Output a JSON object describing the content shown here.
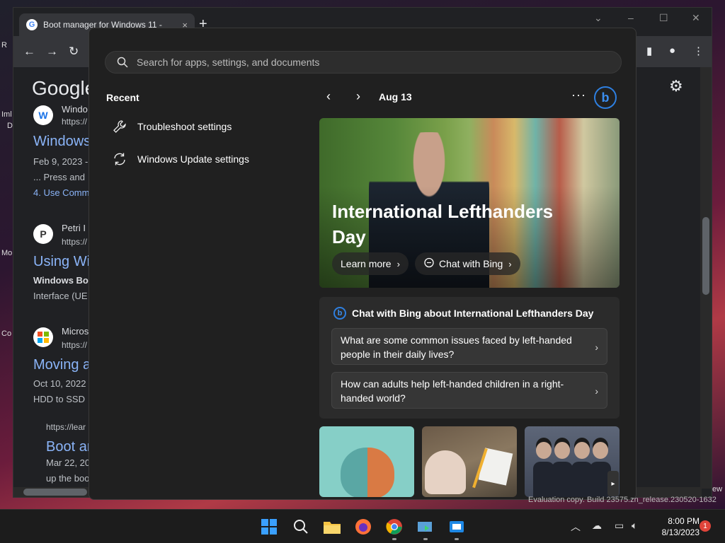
{
  "browser": {
    "tab_title": "Boot manager for Windows 11 -",
    "tab_close": "×",
    "new_tab": "+",
    "logo": "Google",
    "results": [
      {
        "fav": "W",
        "site": "Windo",
        "url": "https://",
        "title": "Windows",
        "snippet1": "Feb 9, 2023 -",
        "snippet2": "... Press and",
        "link": "4. Use Comm"
      },
      {
        "fav": "P",
        "site": "Petri I",
        "url": "https://",
        "title": "Using Wi",
        "snippet1": "Windows Bo",
        "snippet2": "Interface (UE"
      },
      {
        "fav": "",
        "site": "Micros",
        "url": "https://",
        "title": "Moving a",
        "snippet1": "Oct 10, 2022",
        "snippet2": "HDD to SSD"
      },
      {
        "url": "https://lear",
        "title": "Boot ar",
        "snippet1": "Mar 22, 20",
        "snippet2": "up the boo"
      }
    ]
  },
  "flyout": {
    "search_placeholder": "Search for apps, settings, and documents",
    "recent_heading": "Recent",
    "recent_items": [
      {
        "label": "Troubleshoot settings",
        "icon": "wrench-icon"
      },
      {
        "label": "Windows Update settings",
        "icon": "sync-icon"
      }
    ],
    "date": "Aug 13",
    "dots": "···",
    "hero": {
      "title": "International Lefthanders Day",
      "learn_more": "Learn more",
      "chat_bing": "Chat with Bing"
    },
    "bing_card": {
      "heading": "Chat with Bing about International Lefthanders Day",
      "questions": [
        "What are some common issues faced by left-handed people in their daily lives?",
        "How can adults help left-handed children in a right-handed world?"
      ]
    }
  },
  "taskbar": {
    "time": "8:00 PM",
    "date": "8/13/2023",
    "notification_count": "1"
  },
  "watermark": "Evaluation copy. Build 23575.zn_release.230520-1632",
  "desktop": {
    "labels": [
      "R",
      "Iml",
      "D",
      "Mo",
      "Co"
    ],
    "edge_label": "ew"
  },
  "colors": {
    "accent": "#2e7fe0",
    "link": "#8ab4f8",
    "flyout_bg": "#202020"
  }
}
